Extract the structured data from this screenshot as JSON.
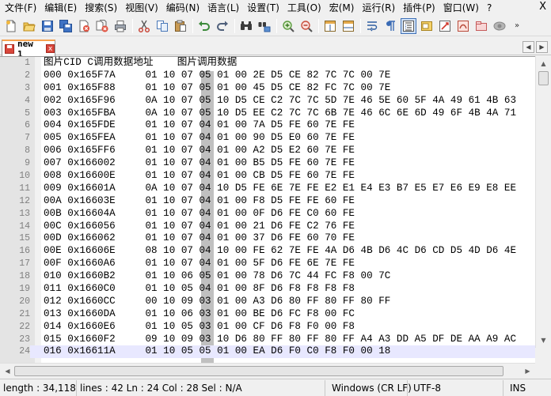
{
  "menu": [
    "文件(F)",
    "编辑(E)",
    "搜索(S)",
    "视图(V)",
    "编码(N)",
    "语言(L)",
    "设置(T)",
    "工具(O)",
    "宏(M)",
    "运行(R)",
    "插件(P)",
    "窗口(W)",
    "?"
  ],
  "menu_close": "X",
  "toolbar_icons": [
    "new-file-icon",
    "open-file-icon",
    "save-icon",
    "save-all-icon",
    "close-icon",
    "close-all-icon",
    "print-icon",
    "cut-icon",
    "copy-icon",
    "paste-icon",
    "undo-icon",
    "redo-icon",
    "find-icon",
    "replace-icon",
    "zoom-in-icon",
    "zoom-out-icon",
    "sync-vertical-icon",
    "sync-horizontal-icon",
    "word-wrap-icon",
    "show-all-chars-icon",
    "indent-guide-icon",
    "document-map-icon",
    "function-list-icon",
    "folder-workspace-icon",
    "record-macro-icon"
  ],
  "toolbar_more": "»",
  "tab": {
    "label": "new 1",
    "close": "x"
  },
  "tab_nav": {
    "left": "◀",
    "right": "▶"
  },
  "lines": [
    {
      "n": "1",
      "text": "图片CID C调用数据地址    图片调用数据"
    },
    {
      "n": "2",
      "text": "000 0x165F7A     01 10 07 05 01 00 2E D5 CE 82 7C 7C 00 7E"
    },
    {
      "n": "3",
      "text": "001 0x165F88     01 10 07 05 01 00 45 D5 CE 82 FC 7C 00 7E"
    },
    {
      "n": "4",
      "text": "002 0x165F96     0A 10 07 05 10 D5 CE C2 7C 7C 5D 7E 46 5E 60 5F 4A 49 61 4B 63"
    },
    {
      "n": "5",
      "text": "003 0x165FBA     0A 10 07 05 10 D5 EE C2 7C 7C 6B 7E 46 6C 6E 6D 49 6F 4B 4A 71"
    },
    {
      "n": "6",
      "text": "004 0x165FDE     01 10 07 04 01 00 7A D5 FE 60 7E FE"
    },
    {
      "n": "7",
      "text": "005 0x165FEA     01 10 07 04 01 00 90 D5 E0 60 7E FE"
    },
    {
      "n": "8",
      "text": "006 0x165FF6     01 10 07 04 01 00 A2 D5 E2 60 7E FE"
    },
    {
      "n": "9",
      "text": "007 0x166002     01 10 07 04 01 00 B5 D5 FE 60 7E FE"
    },
    {
      "n": "10",
      "text": "008 0x16600E     01 10 07 04 01 00 CB D5 FE 60 7E FE"
    },
    {
      "n": "11",
      "text": "009 0x16601A     0A 10 07 04 10 D5 FE 6E 7E FE E2 E1 E4 E3 B7 E5 E7 E6 E9 E8 EE"
    },
    {
      "n": "12",
      "text": "00A 0x16603E     01 10 07 04 01 00 F8 D5 FE FE 60 FE"
    },
    {
      "n": "13",
      "text": "00B 0x16604A     01 10 07 04 01 00 0F D6 FE C0 60 FE"
    },
    {
      "n": "14",
      "text": "00C 0x166056     01 10 07 04 01 00 21 D6 FE C2 76 FE"
    },
    {
      "n": "15",
      "text": "00D 0x166062     01 10 07 04 01 00 37 D6 FE 60 70 FE"
    },
    {
      "n": "16",
      "text": "00E 0x16606E     08 10 07 04 10 00 FE 62 7E FE 4A D6 4B D6 4C D6 CD D5 4D D6 4E"
    },
    {
      "n": "17",
      "text": "00F 0x1660A6     01 10 07 04 01 00 5F D6 FE 6E 7E FE"
    },
    {
      "n": "18",
      "text": "010 0x1660B2     01 10 06 05 01 00 78 D6 7C 44 FC F8 00 7C"
    },
    {
      "n": "19",
      "text": "011 0x1660C0     01 10 05 04 01 00 8F D6 F8 F8 F8 F8"
    },
    {
      "n": "20",
      "text": "012 0x1660CC     00 10 09 03 01 00 A3 D6 80 FF 80 FF 80 FF"
    },
    {
      "n": "21",
      "text": "013 0x1660DA     01 10 06 03 01 00 BE D6 FC F8 00 FC"
    },
    {
      "n": "22",
      "text": "014 0x1660E6     01 10 05 03 01 00 CF D6 F8 F0 00 F8"
    },
    {
      "n": "23",
      "text": "015 0x1660F2     09 10 09 03 10 D6 80 FF 80 FF 80 FF A4 A3 DD A5 DF DE AA A9 AC"
    },
    {
      "n": "24",
      "text": "016 0x16611A     01 10 05 05 01 00 EA D6 F0 C0 F8 F0 00 18"
    }
  ],
  "scroll": {
    "up": "▲",
    "down": "▼",
    "left": "◀",
    "right": "▶"
  },
  "status": {
    "length": "length : 34,118",
    "position": "lines : 42    Ln : 24    Col : 28    Sel : N/A",
    "eol": "Windows (CR LF)",
    "encoding": "UTF-8",
    "mode": "INS"
  },
  "colors": {
    "tab_accent": "#f7a24f",
    "current_line": "#e8e8ff",
    "column_mark": "#c0c0c0",
    "gutter": "#e4e4e4",
    "line_number": "#808080"
  }
}
